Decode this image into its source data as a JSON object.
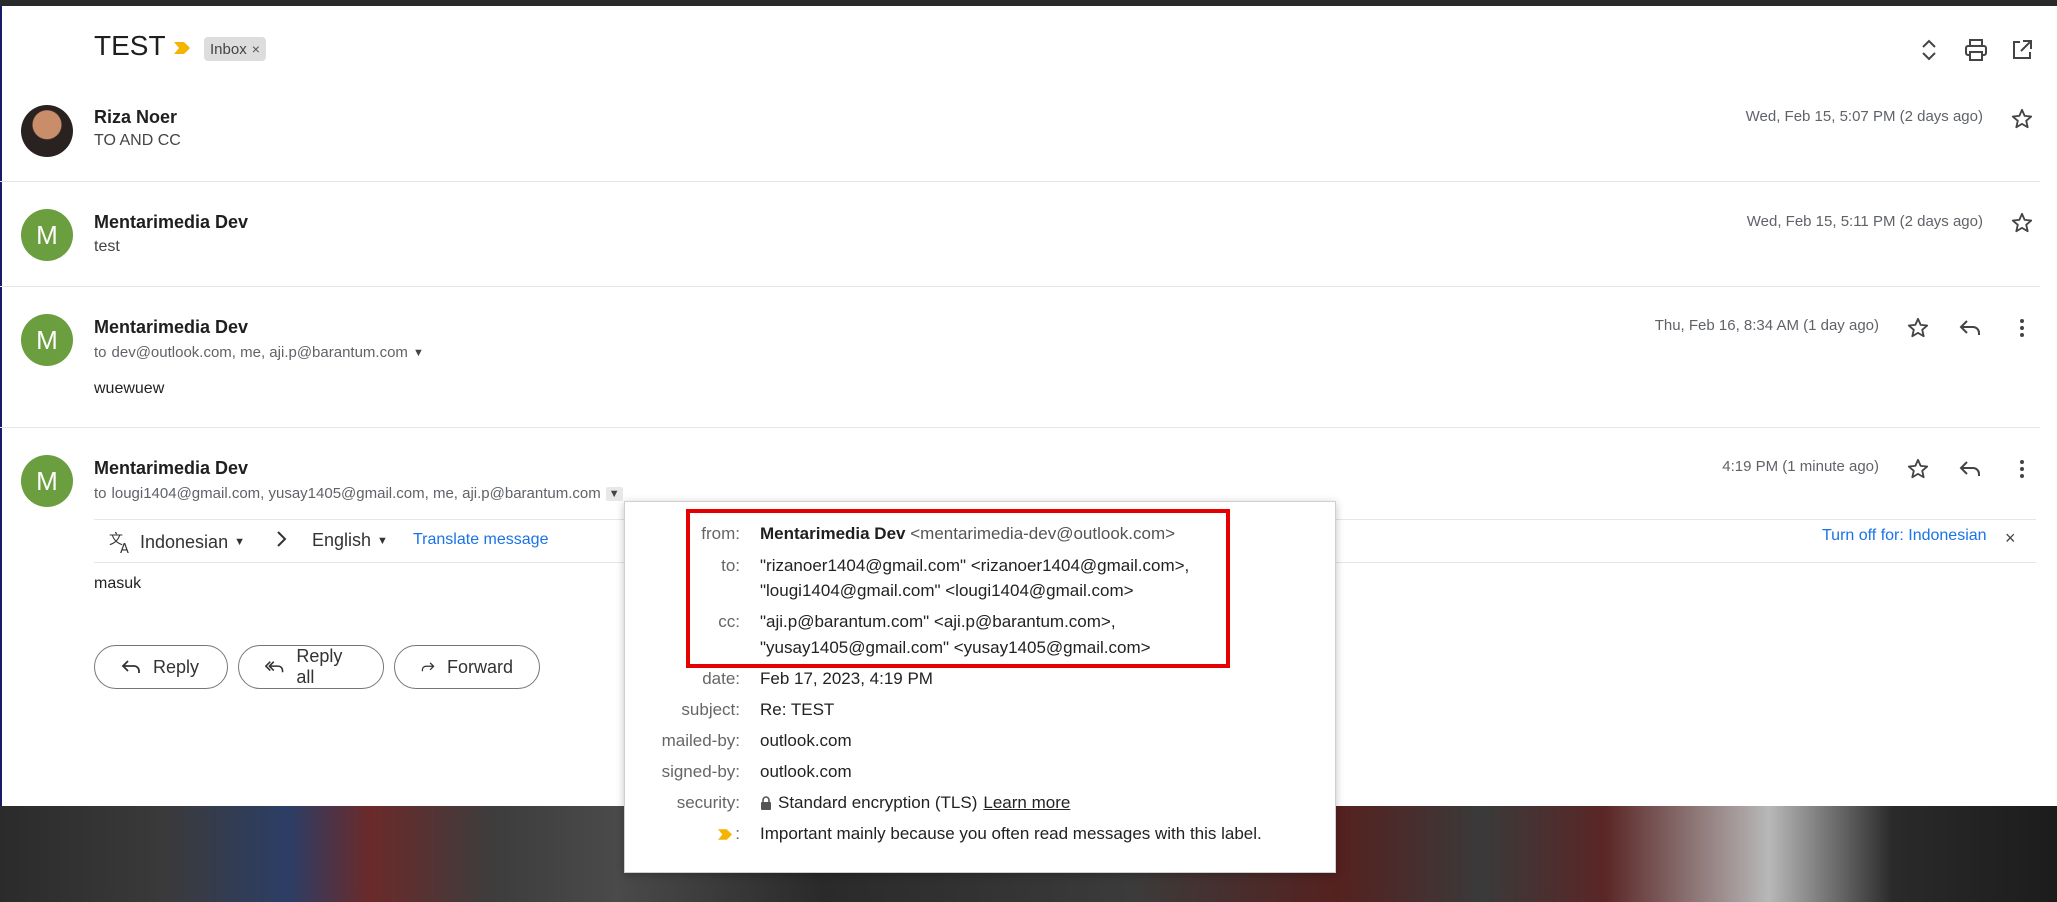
{
  "thread": {
    "subject": "TEST",
    "label_chip": "Inbox",
    "label_chip_remove": "×"
  },
  "messages": [
    {
      "sender": "Riza Noer",
      "snippet": "TO AND CC",
      "date": "Wed, Feb 15, 5:07 PM (2 days ago)",
      "avatar": "photo"
    },
    {
      "sender": "Mentarimedia Dev",
      "snippet": "test",
      "date": "Wed, Feb 15, 5:11 PM (2 days ago)",
      "avatar_letter": "M"
    },
    {
      "sender": "Mentarimedia Dev",
      "to_prefix": "to",
      "recipients": "dev@outlook.com, me, aji.p@barantum.com",
      "body": "wuewuew",
      "date": "Thu, Feb 16, 8:34 AM (1 day ago)",
      "avatar_letter": "M"
    },
    {
      "sender": "Mentarimedia Dev",
      "to_prefix": "to",
      "recipients": "lougi1404@gmail.com, yusay1405@gmail.com, me, aji.p@barantum.com",
      "body": "masuk",
      "date": "4:19 PM (1 minute ago)",
      "avatar_letter": "M"
    }
  ],
  "translate_bar": {
    "source_language": "Indonesian",
    "target_language": "English",
    "translate_link": "Translate message",
    "turn_off_link": "Turn off for: Indonesian"
  },
  "actions": {
    "reply": "Reply",
    "reply_all": "Reply all",
    "forward": "Forward"
  },
  "details": {
    "from_label": "from:",
    "from_name": "Mentarimedia Dev",
    "from_addr": "<mentarimedia-dev@outlook.com>",
    "to_label": "to:",
    "to_line1": "\"rizanoer1404@gmail.com\" <rizanoer1404@gmail.com>,",
    "to_line2": "\"lougi1404@gmail.com\" <lougi1404@gmail.com>",
    "cc_label": "cc:",
    "cc_line1": "\"aji.p@barantum.com\" <aji.p@barantum.com>,",
    "cc_line2": "\"yusay1405@gmail.com\" <yusay1405@gmail.com>",
    "date_label": "date:",
    "date_value": "Feb 17, 2023, 4:19 PM",
    "subject_label": "subject:",
    "subject_value": "Re: TEST",
    "mailed_by_label": "mailed-by:",
    "mailed_by_value": "outlook.com",
    "signed_by_label": "signed-by:",
    "signed_by_value": "outlook.com",
    "security_label": "security:",
    "security_value": "Standard encryption (TLS)",
    "security_link": "Learn more",
    "importance_label": ":",
    "importance_value": "Important mainly because you often read messages with this label."
  },
  "colors": {
    "highlight_box": "#e60000",
    "avatar_green": "#6b9e3e",
    "link_blue": "#1a73e8",
    "importance_yellow": "#f4b400"
  }
}
